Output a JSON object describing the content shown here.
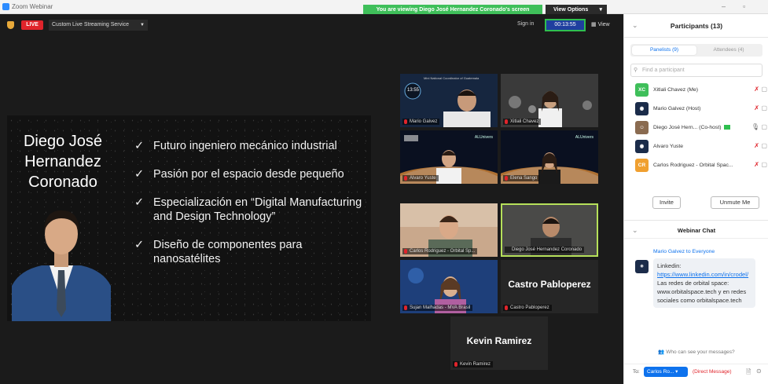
{
  "window": {
    "app_name": "Zoom Webinar"
  },
  "share_banner": {
    "viewing_text": "You are viewing Diego José Hernandez Coronado's screen",
    "view_options": "View Options"
  },
  "topbar": {
    "live_label": "LIVE",
    "stream_service": "Custom Live Streaming Service",
    "signin": "Sign in",
    "timer": "00:13:55",
    "view_label": "View"
  },
  "slide": {
    "name_line1": "Diego José",
    "name_line2": "Hernandez",
    "name_line3": "Coronado",
    "bullets": [
      "Futuro ingeniero mecánico industrial",
      "Pasión por el espacio desde pequeño",
      "Especialización en “Digital Manufacturing and Design Technology”",
      "Diseño de componentes para nanosatélites"
    ]
  },
  "gallery": {
    "tiles": [
      {
        "label": "Mario Galvez",
        "timer_overlay": "13:55",
        "caption": "Mini National Coordinator of Guatemala"
      },
      {
        "label": "Xitlali Chavez"
      },
      {
        "label": "Alvaro Yuste",
        "brand": "ALUnivers"
      },
      {
        "label": "Elena Sango",
        "brand": "ALUnivers"
      },
      {
        "label": "Carlos Rodriguez - Orbital Sp..."
      },
      {
        "label": "Diego José Hernandez Coronado"
      },
      {
        "label": "Sujan Malhadas - MVA Brasil"
      },
      {
        "label": "Castro Pabloperez",
        "big_name": "Castro Pabloperez"
      },
      {
        "label": "Kevin Ramirez",
        "big_name": "Kevin Ramirez"
      }
    ]
  },
  "participants": {
    "title": "Participants (13)",
    "tab_panelists": "Panelists (9)",
    "tab_attendees": "Attendees (4)",
    "search_placeholder": "Find a participant",
    "list": [
      {
        "initials": "XC",
        "color": "#3fbf5a",
        "name": "Xitlali Chavez (Me)"
      },
      {
        "initials": "",
        "color": "#1b2c4a",
        "name": "Mario Galvez (Host)"
      },
      {
        "initials": "",
        "color": "#8a6b50",
        "name": "Diego José Hern...  (Co-host)"
      },
      {
        "initials": "",
        "color": "#1b2c4a",
        "name": "Alvaro Yuste"
      },
      {
        "initials": "CR",
        "color": "#f0a030",
        "name": "Carlos Rodriguez - Orbital Spac..."
      }
    ],
    "invite": "Invite",
    "unmute": "Unmute Me"
  },
  "chat": {
    "title": "Webinar Chat",
    "from": "Mario Galvez to Everyone",
    "line1": "Linkedin:",
    "link": "https://www.linkedin.com/in/crodel/",
    "line2": "Las redes de orbital space: www.orbitalspace.tech y en redes sociales como orbitalspace.tech",
    "who_see": "Who can see your messages?",
    "to_label": "To:",
    "to_select": "Carlos Ro...",
    "direct_message": "(Direct Message)"
  },
  "colors": {
    "accent": "#0e72ed",
    "live": "#e0242b",
    "share_green": "#3fbf5a",
    "speaking_border": "#b6e05a"
  }
}
